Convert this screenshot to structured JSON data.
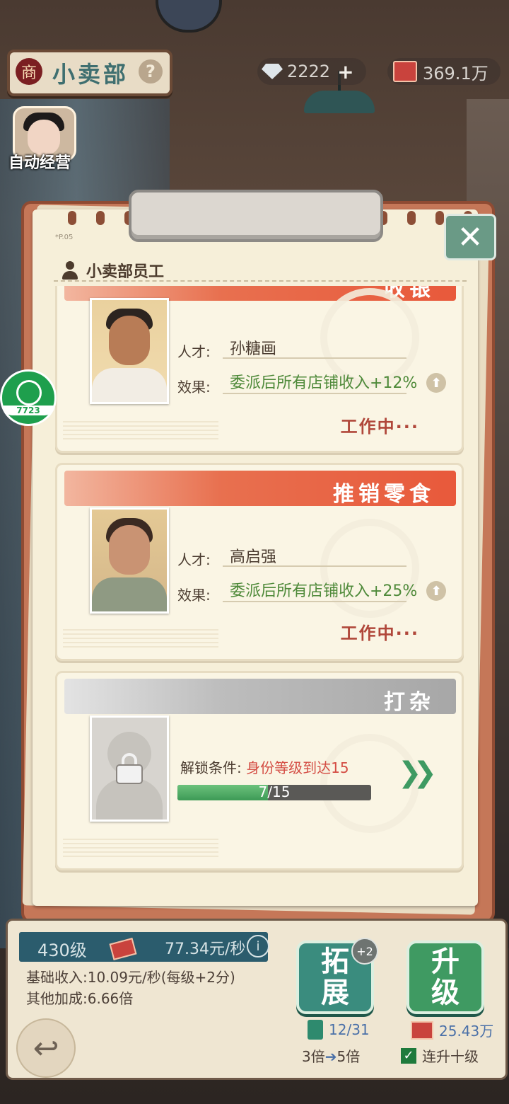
{
  "header": {
    "shop_badge": "商",
    "shop_name": "小卖部",
    "help_symbol": "?",
    "diamonds": "2222",
    "diamond_add": "+",
    "cash": "369.1万",
    "auto_manage_label": "自动经营"
  },
  "panel": {
    "page_no": "*P.05",
    "title": "小卖部员工",
    "close_symbol": "✕"
  },
  "cards": [
    {
      "title": "收银",
      "talent_label": "人才:",
      "talent_name": "孙糖画",
      "effect_label": "效果:",
      "effect": "委派后所有店铺收入+12%",
      "status": "工作中···"
    },
    {
      "title": "推销零食",
      "talent_label": "人才:",
      "talent_name": "高启强",
      "effect_label": "效果:",
      "effect": "委派后所有店铺收入+25%",
      "status": "工作中···"
    },
    {
      "title": "打杂",
      "unlock_label": "解锁条件: ",
      "unlock_condition": "身份等级到达15",
      "progress_text": "7/15",
      "progress_value": 0.4667
    }
  ],
  "side_widget": {
    "label": "7723"
  },
  "bottom": {
    "level": "430级",
    "rate": "77.34元/秒",
    "info_symbol": "i",
    "base_income": "基础收入:10.09元/秒(每级+2分)",
    "other_bonus": "其他加成:6.66倍",
    "expand_label": "拓展",
    "expand_badge": "+2",
    "expand_cost": "12/31",
    "multiplier_from": "3倍",
    "multiplier_arrow": "➔",
    "multiplier_to": "5倍",
    "upgrade_label": "升级",
    "upgrade_cost": "25.43万",
    "combo_check": "✓",
    "combo_label": "连升十级"
  },
  "colors": {
    "card_header_active": "#e8593b",
    "card_header_locked": "#a7a7a7",
    "effect_text": "#4f8a3a",
    "status_text": "#b0473a",
    "unlock_condition": "#d44d44",
    "expand_button": "#3a8c7e",
    "upgrade_button": "#3f9a62"
  }
}
